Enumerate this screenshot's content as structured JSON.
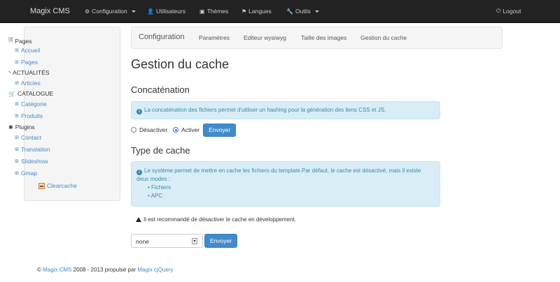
{
  "navbar": {
    "brand": "Magix CMS",
    "items": [
      {
        "label": "Configuration",
        "icon": "wrench-gear-icon",
        "glyph": "⚙",
        "dropdown": true
      },
      {
        "label": "Utilisateurs",
        "icon": "user-icon",
        "glyph": "👤",
        "dropdown": false
      },
      {
        "label": "Thèmes",
        "icon": "book-icon",
        "glyph": "▣",
        "dropdown": false
      },
      {
        "label": "Langues",
        "icon": "flag-icon",
        "glyph": "⚑",
        "dropdown": false
      },
      {
        "label": "Outils",
        "icon": "wrench-icon",
        "glyph": "🔧",
        "dropdown": true
      }
    ],
    "logout": {
      "label": "Logout",
      "icon": "power-icon",
      "glyph": "⏻"
    }
  },
  "sidebar": {
    "pages": {
      "label": "Pages",
      "glyph": "🗎",
      "links": [
        "Accueil",
        "Pages"
      ]
    },
    "news": {
      "label": "ACTUALITÉS",
      "glyph": "◝",
      "links": [
        "Articles"
      ]
    },
    "catalog": {
      "label": "CATALOGUE",
      "glyph": "🛒",
      "links": [
        "Catégorie",
        "Produits"
      ]
    },
    "plugins": {
      "label": "Plugins",
      "glyph": "✱",
      "links": [
        "Contact",
        "Translation",
        "Slideshow",
        "Gmap"
      ]
    },
    "clearcache": "Clearcache",
    "link_glyph": "⊞"
  },
  "tabs": [
    "Configuration",
    "Paramètres",
    "Editeur wysiwyg",
    "Taille des images",
    "Gestion du cache"
  ],
  "main": {
    "title": "Gestion du cache",
    "concat": {
      "heading": "Concaténation",
      "info": "La concaténation des fichiers permet d'utiliser un hashing pour la génération des liens CSS et JS.",
      "option_off": "Désactiver",
      "option_on": "Activer",
      "selected": "Activer",
      "submit": "Envoyer"
    },
    "cache_type": {
      "heading": "Type de cache",
      "info": "Le système permet de mettre en cache les fichiers du template.Par défaut, le cache est désactivé, mais il existe deux modes :",
      "modes": [
        "Fichiers",
        "APC"
      ],
      "warning": "Il est recommandé de désactiver le cache en développement.",
      "select_value": "none",
      "submit": "Envoyer"
    },
    "info_glyph": "i"
  },
  "footer": {
    "copyright": "©",
    "brand_link": "Magix CMS",
    "middle": "2008 - 2013 propulsé par",
    "engine_link": "Magix cjQuery"
  },
  "colors": {
    "navbar_bg": "#222222",
    "link": "#428bca",
    "primary_button": "#428bca",
    "info_bg": "#d9edf7",
    "info_text": "#3a87ad"
  }
}
